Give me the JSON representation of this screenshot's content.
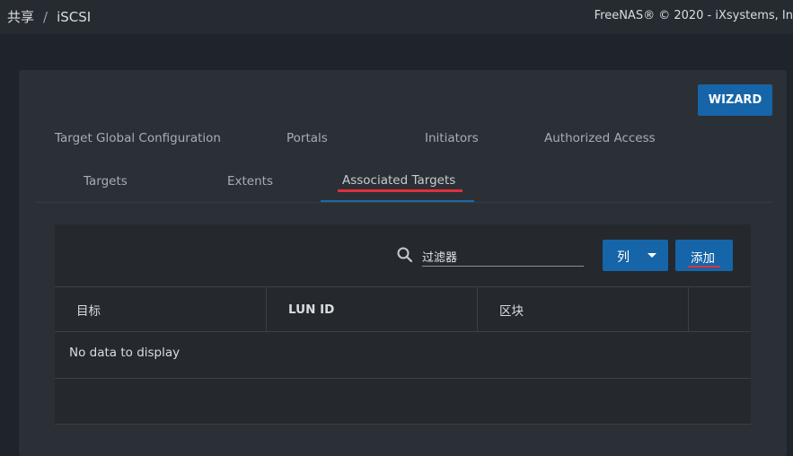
{
  "breadcrumb": {
    "share": "共享",
    "separator": "/",
    "current": "iSCSI"
  },
  "copyright": "FreeNAS® © 2020 - iXsystems, In",
  "wizard_label": "WIZARD",
  "tabs_row1": [
    "Target Global Configuration",
    "Portals",
    "Initiators",
    "Authorized Access"
  ],
  "tabs_row2": [
    "Targets",
    "Extents",
    "Associated Targets"
  ],
  "active_tab": "Associated Targets",
  "toolbar": {
    "search_icon": "search-icon",
    "filter_value": "过滤器",
    "columns_label": "列",
    "add_label": "添加"
  },
  "table": {
    "columns": [
      "目标",
      "LUN ID",
      "区块"
    ],
    "empty_message": "No data to display"
  },
  "colors": {
    "accent": "#1565a8",
    "highlight": "#e0303a",
    "background": "#1f242a",
    "card": "#2b3036"
  }
}
